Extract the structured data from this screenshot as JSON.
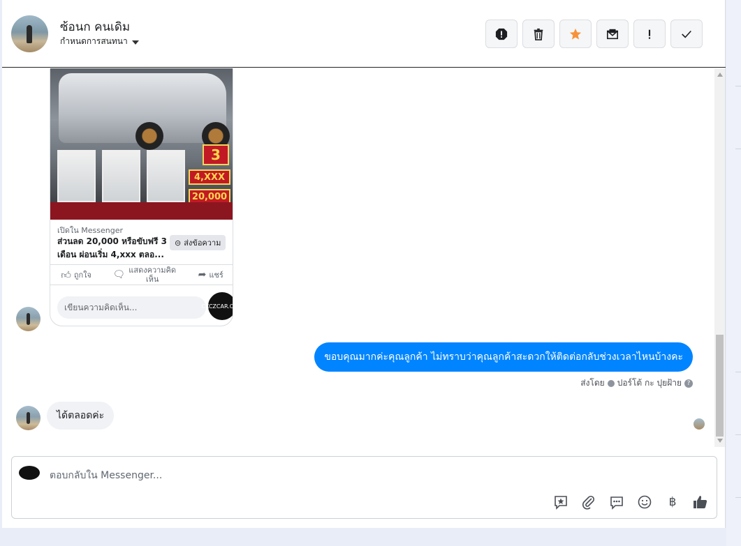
{
  "header": {
    "contact_name": "ซ้อนก คนเดิม",
    "status_label": "กำหนดการสนทนา"
  },
  "toolbar": {
    "buttons": [
      {
        "name": "spam",
        "icon": "stop-alert-icon"
      },
      {
        "name": "delete",
        "icon": "trash-icon"
      },
      {
        "name": "star",
        "icon": "star-icon"
      },
      {
        "name": "mark-unread",
        "icon": "envelope-icon"
      },
      {
        "name": "important",
        "icon": "exclamation-icon"
      },
      {
        "name": "done",
        "icon": "check-icon"
      }
    ],
    "star_color": "#f7923a"
  },
  "card": {
    "image_price_1": "4,XXX",
    "image_price_2": "20,000",
    "image_badge": "3",
    "source": "เปิดใน Messenger",
    "title": "ส่วนลด 20,000 หรือขับฟรี 3 เดือน ผ่อนเริ่ม 4,xxx ตลอ...",
    "send_label": "ส่งข้อความ",
    "like_label": "ถูกใจ",
    "comment_label": "แสดงความคิดเห็น",
    "share_label": "แชร์",
    "comment_placeholder": "เขียนความคิดเห็น...",
    "logo_text": "CKCZCAR.COM"
  },
  "messages": {
    "outgoing_text": "ขอบคุณมากค่ะคุณลูกค้า ไม่ทราบว่าคุณลูกค้าสะดวกให้ติดต่อกลับช่วงเวลาไหนบ้างคะ",
    "sent_by_prefix": "ส่งโดย",
    "sent_by_name": "ปอร์โต้ กะ ปุยฝ้าย",
    "incoming_text": "ได้ตลอดค่ะ",
    "bubble_color": "#0084ff"
  },
  "composer": {
    "placeholder": "ตอบกลับใน Messenger...",
    "icons": [
      "sticker-star-icon",
      "paperclip-icon",
      "saved-reply-icon",
      "emoji-icon",
      "baht-icon",
      "thumbs-up-icon"
    ]
  }
}
